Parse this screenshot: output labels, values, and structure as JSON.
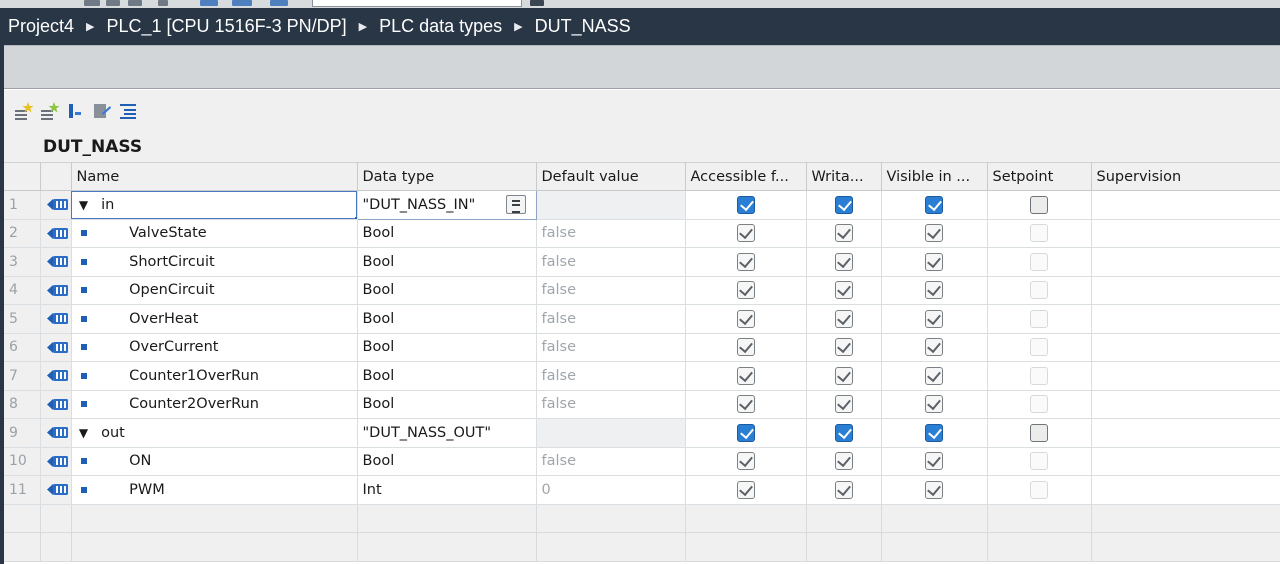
{
  "breadcrumb": [
    "Project4",
    "PLC_1 [CPU 1516F-3 PN/DP]",
    "PLC data types",
    "DUT_NASS"
  ],
  "breadcrumb_separator": "▶",
  "toolbar": {
    "icons": [
      "insert-row-icon",
      "add-row-icon",
      "expand-icon",
      "monitor-icon",
      "tree-view-icon"
    ]
  },
  "object_title": "DUT_NASS",
  "columns": [
    "Name",
    "Data type",
    "Default value",
    "Accessible f...",
    "Writa...",
    "Visible in ...",
    "Setpoint",
    "Supervision"
  ],
  "rows": [
    {
      "num": "1",
      "level": 0,
      "expanded": true,
      "name": "in",
      "datatype": "\"DUT_NASS_IN\"",
      "default": "",
      "accessible": true,
      "writable": true,
      "visible": true,
      "setpoint": false,
      "supervision": ""
    },
    {
      "num": "2",
      "level": 1,
      "name": "ValveState",
      "datatype": "Bool",
      "default": "false",
      "accessible": true,
      "writable": true,
      "visible": true,
      "setpoint": false,
      "supervision": ""
    },
    {
      "num": "3",
      "level": 1,
      "name": "ShortCircuit",
      "datatype": "Bool",
      "default": "false",
      "accessible": true,
      "writable": true,
      "visible": true,
      "setpoint": false,
      "supervision": ""
    },
    {
      "num": "4",
      "level": 1,
      "name": "OpenCircuit",
      "datatype": "Bool",
      "default": "false",
      "accessible": true,
      "writable": true,
      "visible": true,
      "setpoint": false,
      "supervision": ""
    },
    {
      "num": "5",
      "level": 1,
      "name": "OverHeat",
      "datatype": "Bool",
      "default": "false",
      "accessible": true,
      "writable": true,
      "visible": true,
      "setpoint": false,
      "supervision": ""
    },
    {
      "num": "6",
      "level": 1,
      "name": "OverCurrent",
      "datatype": "Bool",
      "default": "false",
      "accessible": true,
      "writable": true,
      "visible": true,
      "setpoint": false,
      "supervision": ""
    },
    {
      "num": "7",
      "level": 1,
      "name": "Counter1OverRun",
      "datatype": "Bool",
      "default": "false",
      "accessible": true,
      "writable": true,
      "visible": true,
      "setpoint": false,
      "supervision": ""
    },
    {
      "num": "8",
      "level": 1,
      "name": "Counter2OverRun",
      "datatype": "Bool",
      "default": "false",
      "accessible": true,
      "writable": true,
      "visible": true,
      "setpoint": false,
      "supervision": ""
    },
    {
      "num": "9",
      "level": 0,
      "expanded": true,
      "name": "out",
      "datatype": "\"DUT_NASS_OUT\"",
      "default": "",
      "accessible": true,
      "writable": true,
      "visible": true,
      "setpoint": false,
      "supervision": ""
    },
    {
      "num": "10",
      "level": 1,
      "name": "ON",
      "datatype": "Bool",
      "default": "false",
      "accessible": true,
      "writable": true,
      "visible": true,
      "setpoint": false,
      "supervision": ""
    },
    {
      "num": "11",
      "level": 1,
      "name": "PWM",
      "datatype": "Int",
      "default": "0",
      "accessible": true,
      "writable": true,
      "visible": true,
      "setpoint": false,
      "supervision": ""
    }
  ],
  "colors": {
    "breadcrumb_bg": "#283646",
    "checkbox_blue": "#2a7fd4",
    "row_bullet": "#1f5fb6"
  }
}
